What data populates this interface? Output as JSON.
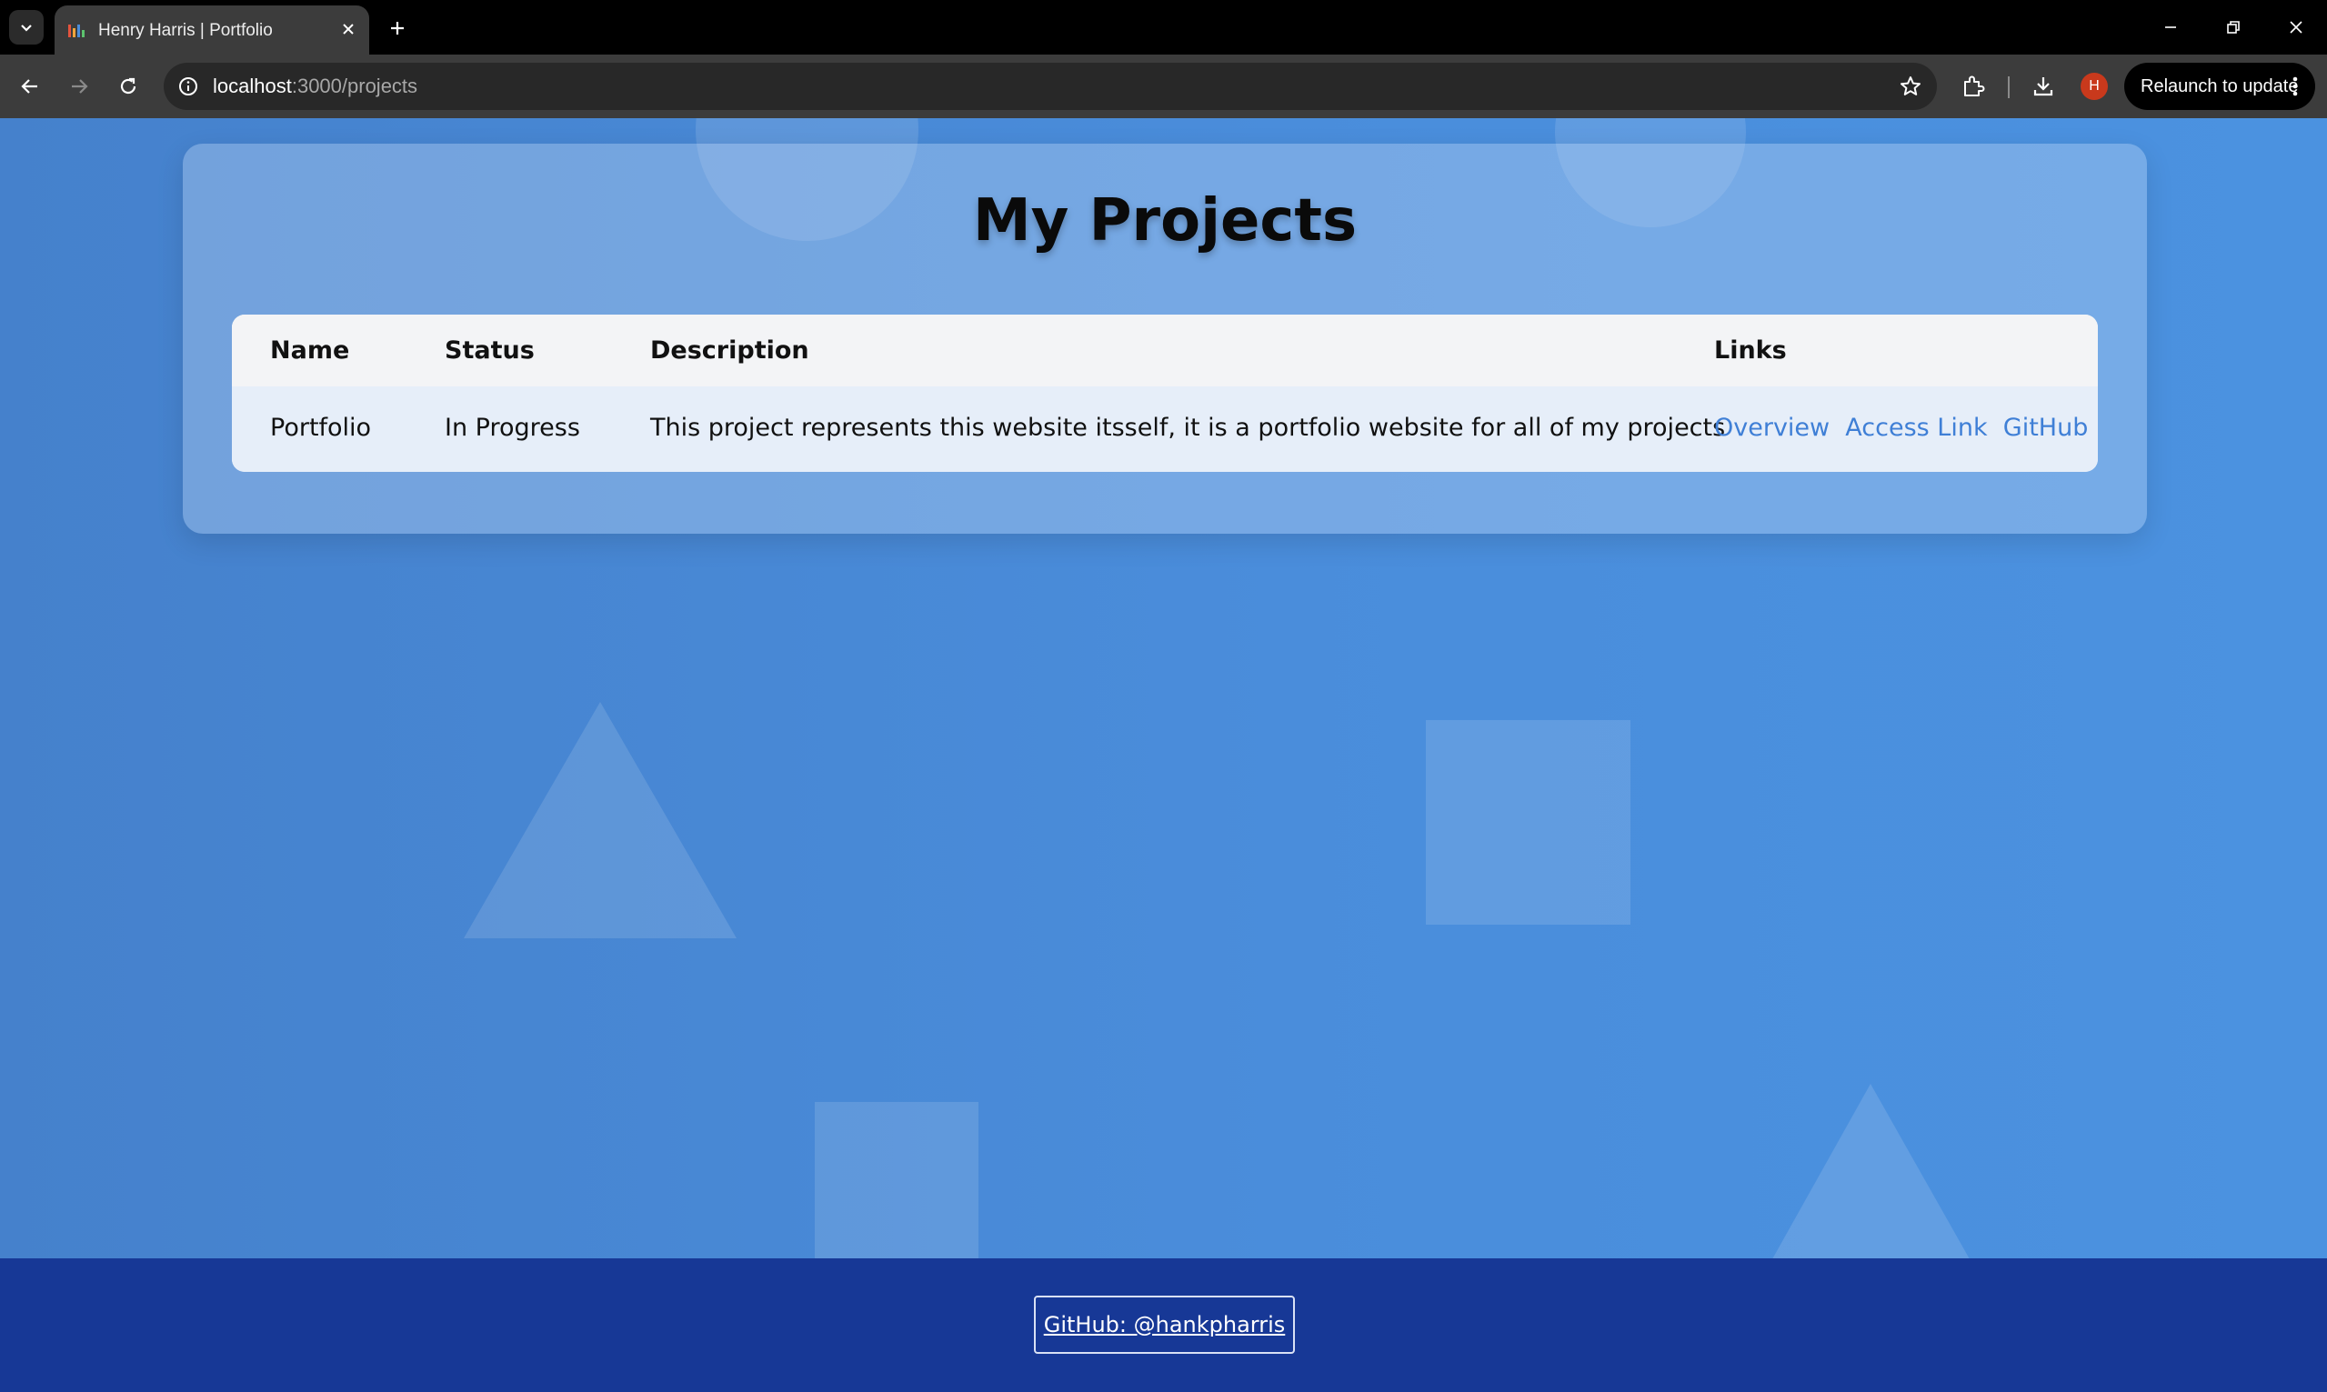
{
  "browser": {
    "tab_title": "Henry Harris | Portfolio",
    "url_host": "localhost",
    "url_path": ":3000/projects",
    "profile_initial": "H",
    "relaunch_label": "Relaunch to update"
  },
  "page": {
    "title": "My Projects",
    "table": {
      "headers": {
        "name": "Name",
        "status": "Status",
        "description": "Description",
        "links": "Links"
      },
      "rows": [
        {
          "name": "Portfolio",
          "status": "In Progress",
          "description": "This project represents this website itsself, it is a portfolio website for all of my projects",
          "links": {
            "overview": "Overview",
            "access": "Access Link",
            "github": "GitHub"
          }
        }
      ]
    }
  },
  "footer": {
    "github_label": "GitHub: @hankpharris"
  },
  "colors": {
    "page_background": "#4a8ddb",
    "footer_background": "#173896",
    "link": "#3f7fd6"
  }
}
